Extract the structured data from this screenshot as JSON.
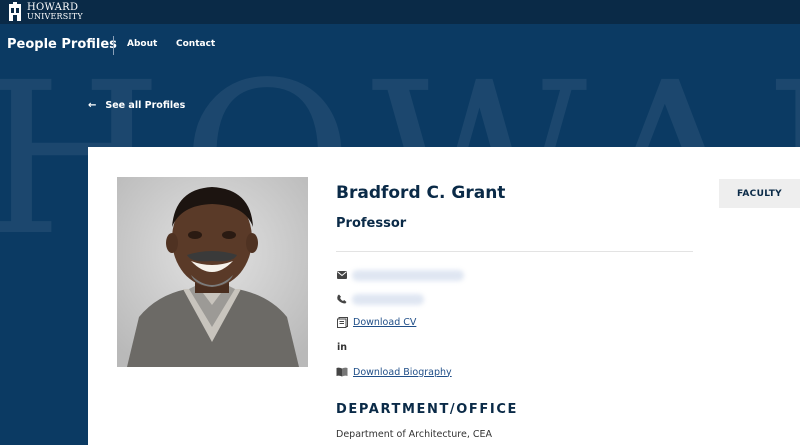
{
  "header": {
    "logo_line1": "HOWARD",
    "logo_line2": "UNIVERSITY"
  },
  "nav": {
    "site_title": "People Profiles",
    "links": [
      "About",
      "Contact"
    ]
  },
  "watermark_text": "HOWARD",
  "back_link": "See all Profiles",
  "profile": {
    "name": "Bradford C. Grant",
    "title": "Professor",
    "badge": "FACULTY",
    "cv_link": "Download CV",
    "linkedin_label": "in",
    "biography_link": "Download Biography",
    "department_heading": "DEPARTMENT/OFFICE",
    "department": "Department of Architecture, CEA"
  },
  "icons": {
    "email": "envelope-icon",
    "phone": "phone-icon",
    "cv": "document-icon",
    "linkedin": "linkedin-icon",
    "biography": "book-icon",
    "back": "arrow-left-icon"
  },
  "colors": {
    "page_background": "#0b3a63",
    "topbar": "#0a2a47",
    "heading_text": "#0a2a47",
    "link": "#1f4e88",
    "badge_background": "#eeeeee"
  }
}
